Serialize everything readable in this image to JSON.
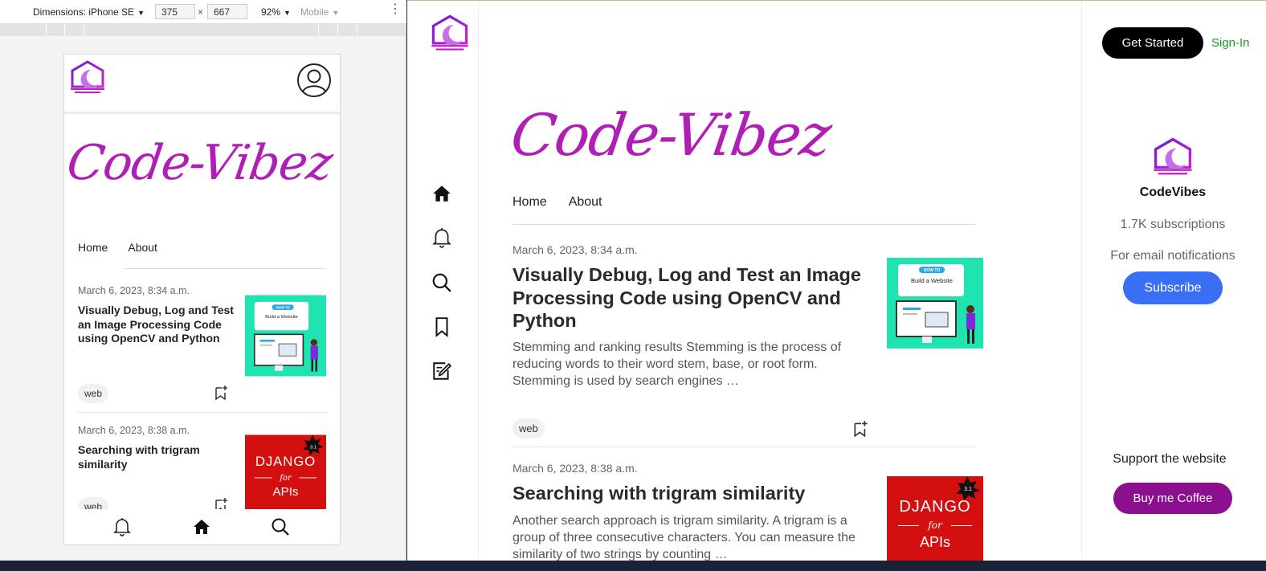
{
  "devtools": {
    "dimensions_label": "Dimensions: iPhone SE",
    "width_value": "375",
    "times": "×",
    "height_value": "667",
    "zoom": "92%",
    "mode": "Mobile",
    "menu_glyph": "⋮",
    "caret": "▼"
  },
  "site": {
    "brand": "Code-Vibez",
    "nav": [
      "Home",
      "About"
    ],
    "posts": [
      {
        "date": "March 6, 2023, 8:34 a.m.",
        "title": "Visually Debug, Log and Test an Image Processing Code using OpenCV and Python",
        "excerpt": "Stemming and ranking results Stemming is the process of reducing words to their word stem, base, or root form. Stemming is used by search engines …",
        "tag": "web",
        "thumb": {
          "badge": "HOW TO",
          "caption": "Build a Website",
          "bg": "#1fe3b0"
        }
      },
      {
        "date": "March 6, 2023, 8:38 a.m.",
        "title": "Searching with trigram similarity",
        "excerpt": "Another search approach is trigram similarity. A trigram is a group of three consecutive characters. You can measure the similarity of two strings by counting …",
        "tag": "web",
        "thumb": {
          "line1": "DJANGO",
          "line2": "for",
          "line3": "APIs",
          "star": "3.1",
          "bg": "#d40f0f"
        }
      }
    ],
    "sidebar": {
      "get_started": "Get Started",
      "sign_in": "Sign-In",
      "channel_name": "CodeVibes",
      "subscriptions": "1.7K subscriptions",
      "email_note": "For email notifications",
      "subscribe": "Subscribe",
      "support": "Support the website",
      "coffee": "Buy me Coffee"
    }
  },
  "colors": {
    "brand_magenta": "#b01fb5",
    "logo_purple": "#8a2be2",
    "subscribe_blue": "#3b6ff3",
    "coffee_purple": "#8b0f8e",
    "signin_green": "#1a9c1a"
  },
  "icons": [
    "logo-icon",
    "avatar-icon",
    "home-icon",
    "bell-icon",
    "search-icon",
    "bookmark-icon",
    "write-icon",
    "bookmark-add-icon"
  ]
}
